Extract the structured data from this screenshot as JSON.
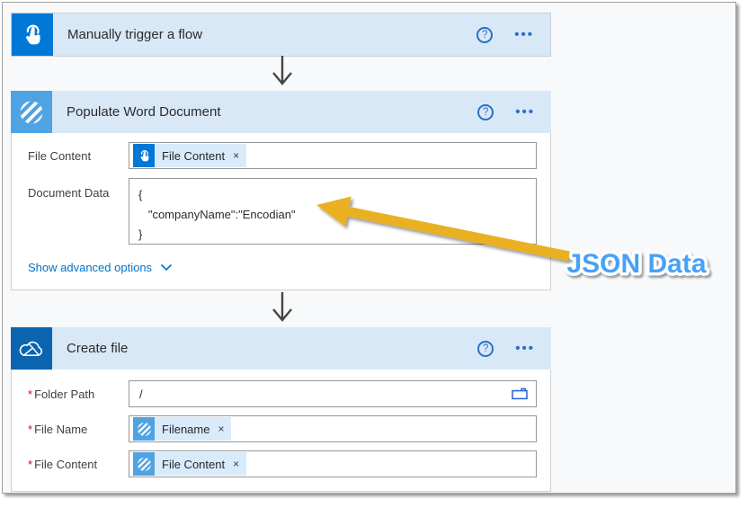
{
  "glyphs": {
    "help": "?",
    "menu": "•••",
    "remove": "×",
    "required": "*"
  },
  "trigger_card": {
    "title": "Manually trigger a flow"
  },
  "populate_card": {
    "title": "Populate Word Document",
    "file_content_label": "File Content",
    "file_content_token": "File Content",
    "document_data_label": "Document Data",
    "document_data_lines": {
      "l1": "{",
      "l2": "   \"companyName\":\"Encodian\"",
      "l3": "}"
    },
    "advanced_link": "Show advanced options"
  },
  "create_card": {
    "title": "Create file",
    "folder_path_label": "Folder Path",
    "folder_path_value": "/",
    "file_name_label": "File Name",
    "file_name_token": "Filename",
    "file_content_label": "File Content",
    "file_content_token": "File Content"
  },
  "annotation": {
    "label": "JSON Data"
  },
  "colors": {
    "trigger_icon_bg": "#0078D7",
    "encodian_icon_bg": "#4FA3E3",
    "onedrive_icon_bg": "#0A64B0",
    "card_header_bg": "#D9E8F7",
    "token_chip_bg": "#D9EAFB",
    "link_blue": "#0173C7",
    "connector_gray": "#454545",
    "annotation_arrow_gold": "#E9B122",
    "annotation_text_blue": "#46A1F6",
    "required_red": "#C50F1F"
  }
}
